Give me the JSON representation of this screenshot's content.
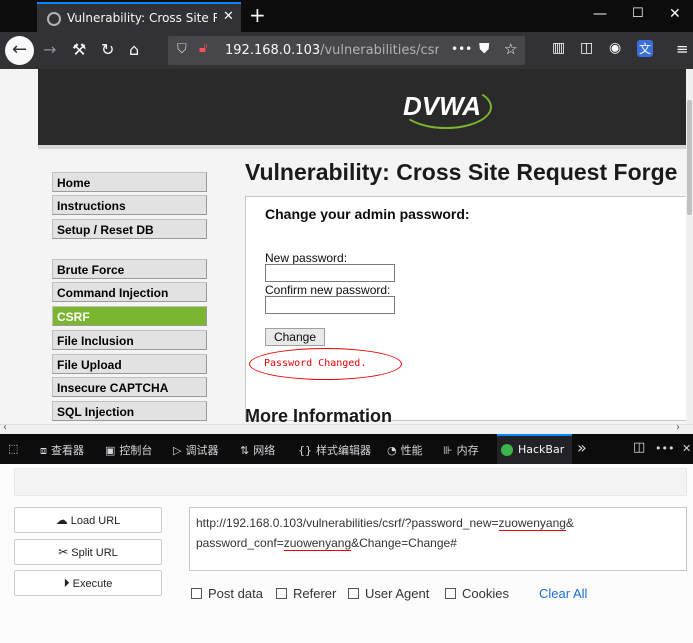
{
  "browser": {
    "tab_title": "Vulnerability: Cross Site Requ",
    "tab_close": "✕",
    "new_tab": "+",
    "url_host": "192.168.0.103",
    "url_path": "/vulnerabilities/csrf/?p",
    "url_more": "•••",
    "accent": "#0a84ff"
  },
  "dvwa": {
    "logo": "DVWA",
    "menu_top": [
      "Home",
      "Instructions",
      "Setup / Reset DB"
    ],
    "menu_vulns": [
      "Brute Force",
      "Command Injection",
      "CSRF",
      "File Inclusion",
      "File Upload",
      "Insecure CAPTCHA",
      "SQL Injection"
    ],
    "selected": "CSRF",
    "selected_color": "#7ab630",
    "page_title": "Vulnerability: Cross Site Request Forge",
    "form_title": "Change your admin password:",
    "new_password_label": "New password:",
    "confirm_label": "Confirm new password:",
    "change_button": "Change",
    "result_message": "Password Changed.",
    "more_info": "More Information"
  },
  "devtools": {
    "tabs": [
      "查看器",
      "控制台",
      "调试器",
      "网络",
      "样式编辑器",
      "性能",
      "内存"
    ],
    "active_tab": "HackBar",
    "overflow": "»",
    "more": "•••"
  },
  "hackbar": {
    "load_url": "Load URL",
    "split_url": "Split URL",
    "execute": "Execute",
    "url_line1_prefix": "http://192.168.0.103/vulnerabilities/csrf/?password_new=",
    "url_line1_value": "zuowenyang",
    "url_line1_suffix": "&",
    "url_line2_prefix": "password_conf=",
    "url_line2_value": "zuowenyang",
    "url_line2_suffix": "&Change=Change#",
    "options": [
      "Post data",
      "Referer",
      "User Agent",
      "Cookies"
    ],
    "clear_all": "Clear All"
  }
}
